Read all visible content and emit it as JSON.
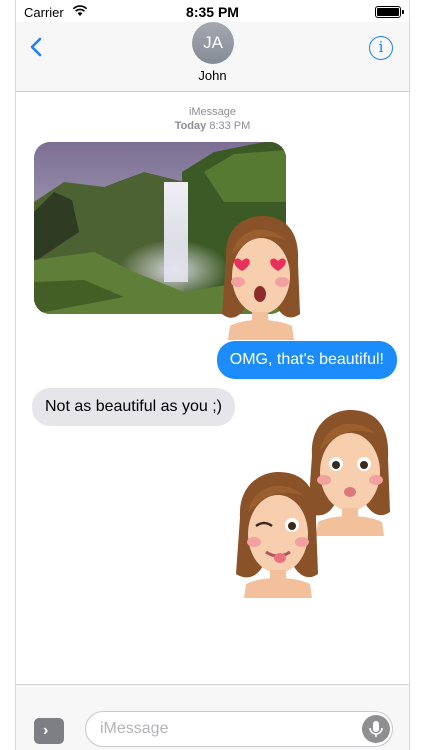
{
  "status_bar": {
    "carrier": "Carrier",
    "time": "8:35 PM",
    "battery_level": 1.0
  },
  "nav": {
    "contact_initials": "JA",
    "contact_name": "John",
    "back_icon": "chevron-left-icon",
    "info_icon": "info-icon",
    "info_glyph": "i"
  },
  "conversation": {
    "service": "iMessage",
    "day": "Today",
    "time": "8:33 PM",
    "messages": [
      {
        "type": "photo",
        "direction": "incoming",
        "content": "waterfall landscape photo"
      },
      {
        "type": "sticker",
        "content": "girl heart-eyes emoji sticker"
      },
      {
        "type": "text",
        "direction": "outgoing",
        "text": "OMG, that's beautiful!"
      },
      {
        "type": "text",
        "direction": "incoming",
        "text": "Not as beautiful as you ;)"
      },
      {
        "type": "sticker",
        "content": "girl pouting emoji sticker"
      },
      {
        "type": "sticker",
        "content": "girl winking tongue-out emoji sticker"
      }
    ]
  },
  "input_bar": {
    "apps_glyph": "›",
    "placeholder": "iMessage",
    "mic_icon": "microphone-icon"
  },
  "colors": {
    "outgoing_bubble": "#1c8cfb",
    "incoming_bubble": "#e5e5ea",
    "accent": "#1a82fb",
    "timestamp": "#8e8e93"
  }
}
